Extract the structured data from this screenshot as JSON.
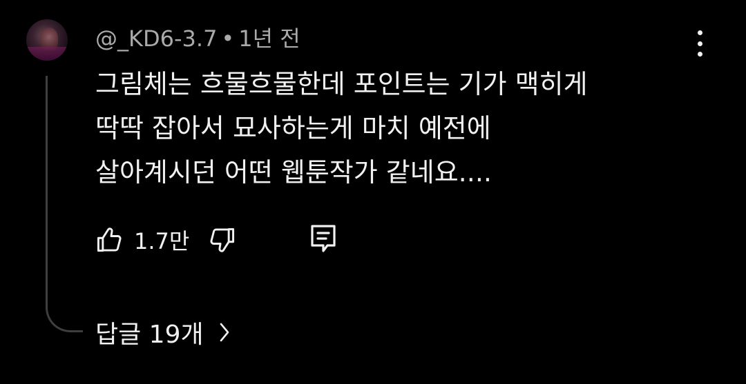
{
  "comment": {
    "author": "@_KD6-3.7",
    "separator": "•",
    "time": "1년 전",
    "lines": [
      "그림체는 흐물흐물한데 포인트는 기가 맥히게",
      "딱딱 잡아서 묘사하는게 마치 예전에",
      "살아계시던 어떤 웹툰작가 같네요...."
    ],
    "like_count": "1.7만",
    "replies_label": "답글 19개"
  },
  "icons": {
    "more": "more-vert-icon",
    "like": "thumbs-up-icon",
    "dislike": "thumbs-down-icon",
    "reply": "comment-reply-icon",
    "chevron": "chevron-right-icon"
  },
  "colors": {
    "background": "#000000",
    "text": "#f1f1f1",
    "meta_text": "#aaaaaa",
    "thread_line": "#3f3f3f"
  }
}
